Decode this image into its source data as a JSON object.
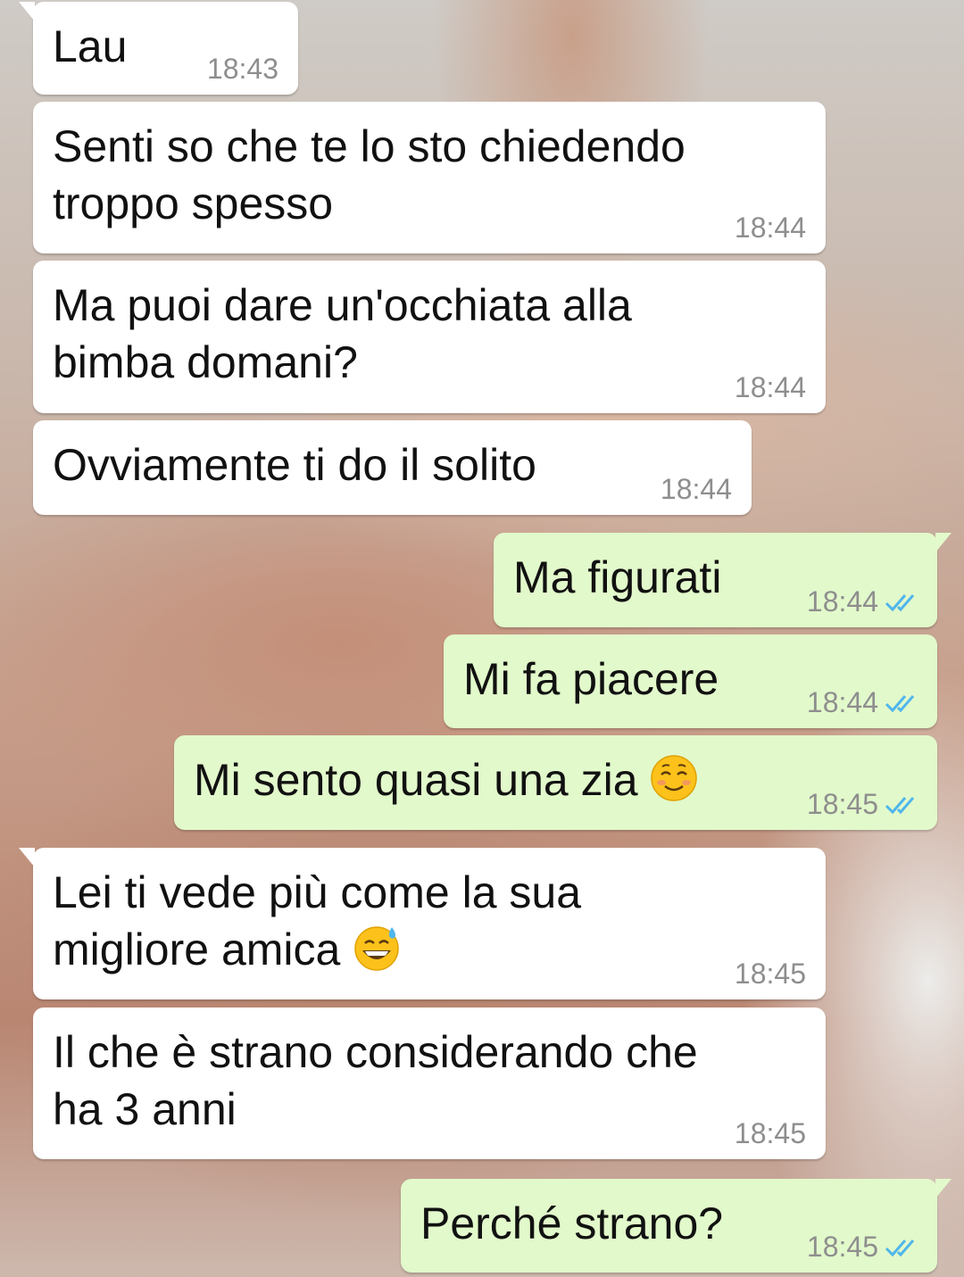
{
  "messages": [
    {
      "direction": "incoming",
      "text": "Lau",
      "time": "18:43"
    },
    {
      "direction": "incoming",
      "text": "Senti so che te lo sto chiedendo\ntroppo spesso",
      "time": "18:44"
    },
    {
      "direction": "incoming",
      "text": "Ma puoi dare un'occhiata alla\nbimba domani?",
      "time": "18:44"
    },
    {
      "direction": "incoming",
      "text": "Ovviamente ti do il solito",
      "time": "18:44"
    },
    {
      "direction": "outgoing",
      "text": "Ma figurati",
      "time": "18:44",
      "status": "read"
    },
    {
      "direction": "outgoing",
      "text": "Mi fa piacere",
      "time": "18:44",
      "status": "read"
    },
    {
      "direction": "outgoing",
      "text": "Mi sento quasi una zia ",
      "emoji": "smiling-face-icon",
      "time": "18:45",
      "status": "read"
    },
    {
      "direction": "incoming",
      "text": "Lei ti vede più come la sua\nmigliore amica ",
      "emoji": "grinning-sweat-icon",
      "time": "18:45"
    },
    {
      "direction": "incoming",
      "text": "Il che è strano considerando che\nha 3 anni",
      "time": "18:45"
    },
    {
      "direction": "outgoing",
      "text": "Perché strano?",
      "time": "18:45",
      "status": "read"
    }
  ],
  "colors": {
    "incoming_bubble": "#ffffff",
    "outgoing_bubble": "#e2f9cb",
    "read_tick": "#4fb6ec",
    "timestamp": "#8e8e8e"
  }
}
